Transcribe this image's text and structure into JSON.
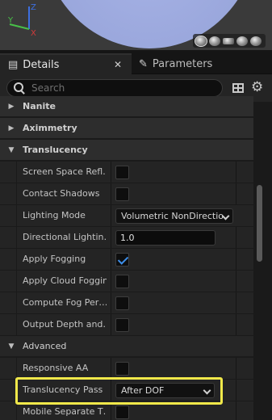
{
  "viewport": {
    "axes": {
      "z": "Z",
      "y": "Y",
      "x": "X"
    },
    "preview_buttons": [
      "sphere-preview-icon",
      "cylinder-preview-icon",
      "plane-preview-icon",
      "cube-preview-icon",
      "mesh-preview-icon"
    ]
  },
  "tabs": [
    {
      "label": "Details",
      "icon": "details-icon",
      "active": true,
      "close": "✕"
    },
    {
      "label": "Parameters",
      "icon": "parameters-icon",
      "active": false
    }
  ],
  "search": {
    "placeholder": "Search",
    "value": ""
  },
  "categories": {
    "nanite": "Nanite",
    "aximmetry": "Aximmetry",
    "translucency": "Translucency",
    "advanced": "Advanced"
  },
  "properties": [
    {
      "label": "Screen Space Refl…",
      "type": "checkbox",
      "checked": false
    },
    {
      "label": "Contact Shadows",
      "type": "checkbox",
      "checked": false
    },
    {
      "label": "Lighting Mode",
      "type": "dropdown",
      "value": "Volumetric NonDirectio"
    },
    {
      "label": "Directional Lightin…",
      "type": "number",
      "value": "1.0"
    },
    {
      "label": "Apply Fogging",
      "type": "checkbox",
      "checked": true
    },
    {
      "label": "Apply Cloud Fogging",
      "type": "checkbox",
      "checked": false
    },
    {
      "label": "Compute Fog Per…",
      "type": "checkbox",
      "checked": false
    },
    {
      "label": "Output Depth and…",
      "type": "checkbox",
      "checked": false
    }
  ],
  "advanced_properties": [
    {
      "label": "Responsive AA",
      "type": "checkbox",
      "checked": false
    },
    {
      "label": "Translucency Pass",
      "type": "dropdown",
      "value": "After DOF",
      "highlighted": true
    },
    {
      "label": "Mobile Separate T…",
      "type": "checkbox",
      "checked": false
    }
  ],
  "colors": {
    "highlight": "#f0e84a",
    "check": "#3d8ee8",
    "panel": "#242424"
  }
}
